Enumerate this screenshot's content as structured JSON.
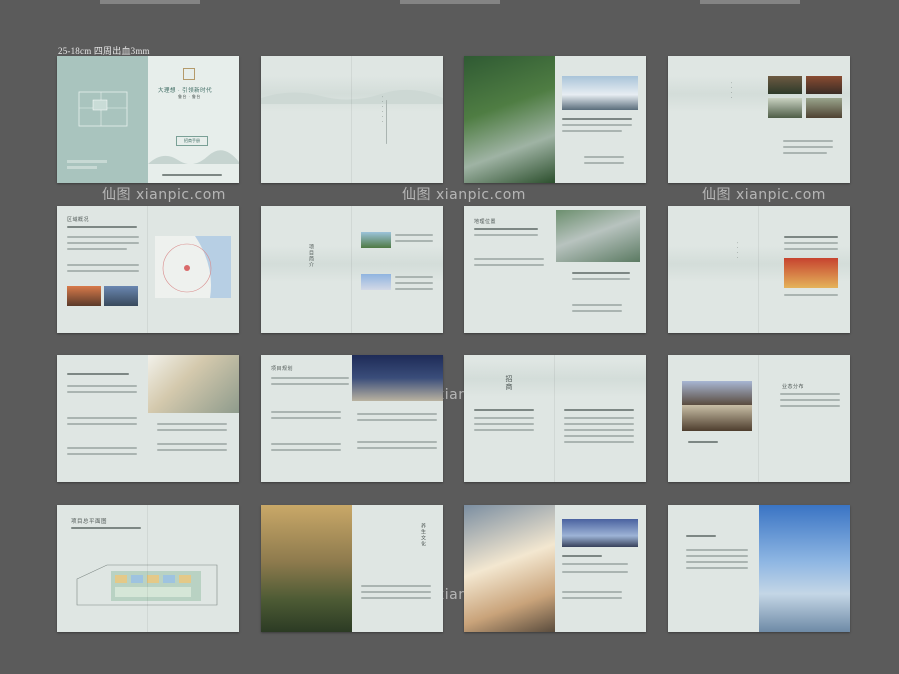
{
  "spec_label": "25-18cm 四周出血3mm",
  "watermark": "仙图 xianpic.com",
  "cover": {
    "title": "大理想 · 引领新时代",
    "subtitle": "鲁台 · 鲁台",
    "button": "招商手册"
  },
  "spreads_headings": {
    "s5": "区域概况",
    "s6": "项目简介",
    "s9": "地理位置",
    "s10": "项目规划",
    "s11": "招商",
    "s12": "业态分布",
    "s13": "项目总平面图",
    "s14": "养生文化"
  },
  "colors": {
    "background": "#5b5b5b",
    "paper": "#dfe6e3",
    "cover_teal": "#a9c4be",
    "ink": "#4d5654"
  }
}
